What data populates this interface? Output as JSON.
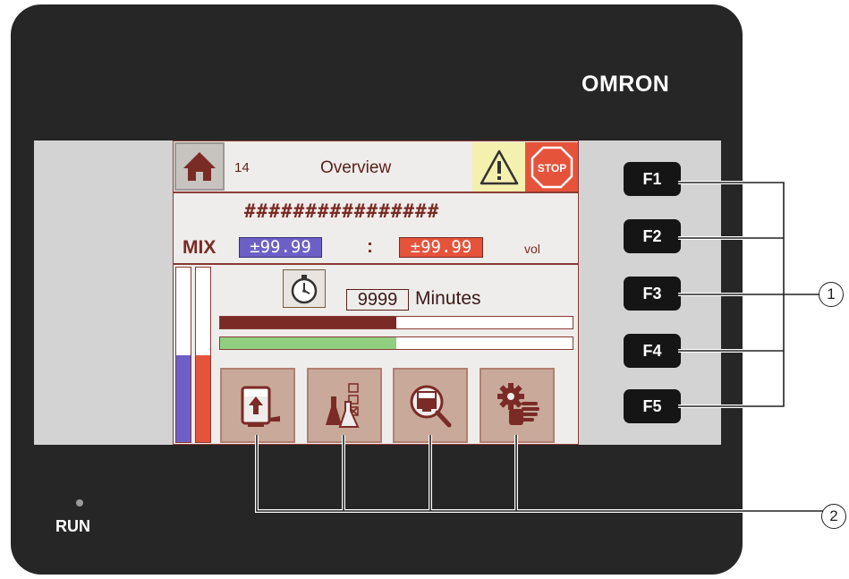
{
  "device": {
    "brand": "OMRON",
    "run_label": "RUN"
  },
  "function_keys": [
    {
      "label": "F1"
    },
    {
      "label": "F2"
    },
    {
      "label": "F3"
    },
    {
      "label": "F4"
    },
    {
      "label": "F5"
    }
  ],
  "callouts": {
    "function_keys": "1",
    "touch_buttons": "2"
  },
  "screen": {
    "header": {
      "screen_number": "14",
      "title": "Overview",
      "stop_label": "STOP"
    },
    "hash_text": "################",
    "mix": {
      "label": "MIX",
      "value_1": "±99.99",
      "separator": ":",
      "value_2": "±99.99",
      "unit": "vol"
    },
    "timer": {
      "value": "9999",
      "unit": "Minutes"
    },
    "level_bars": [
      {
        "name": "level-1",
        "fill_fraction": 0.5,
        "color": "#6c5fc5"
      },
      {
        "name": "level-2",
        "fill_fraction": 0.5,
        "color": "#e5533b"
      }
    ],
    "progress_bars": [
      {
        "name": "progress-1",
        "fill_fraction": 0.5,
        "color": "#7a2b25"
      },
      {
        "name": "progress-2",
        "fill_fraction": 0.5,
        "color": "#8fcf7f"
      }
    ],
    "function_buttons": [
      {
        "icon": "tank-fill-icon"
      },
      {
        "icon": "flask-checklist-icon"
      },
      {
        "icon": "tank-inspect-icon"
      },
      {
        "icon": "gear-hand-icon"
      }
    ]
  },
  "colors": {
    "housing": "#262626",
    "bezel": "#d3d3d3",
    "screen_border": "#8b3a35",
    "accent_red": "#e5533b",
    "accent_blue": "#6c5fc5",
    "accent_green": "#8fcf7f",
    "warning_yellow": "#f4f0ae"
  }
}
